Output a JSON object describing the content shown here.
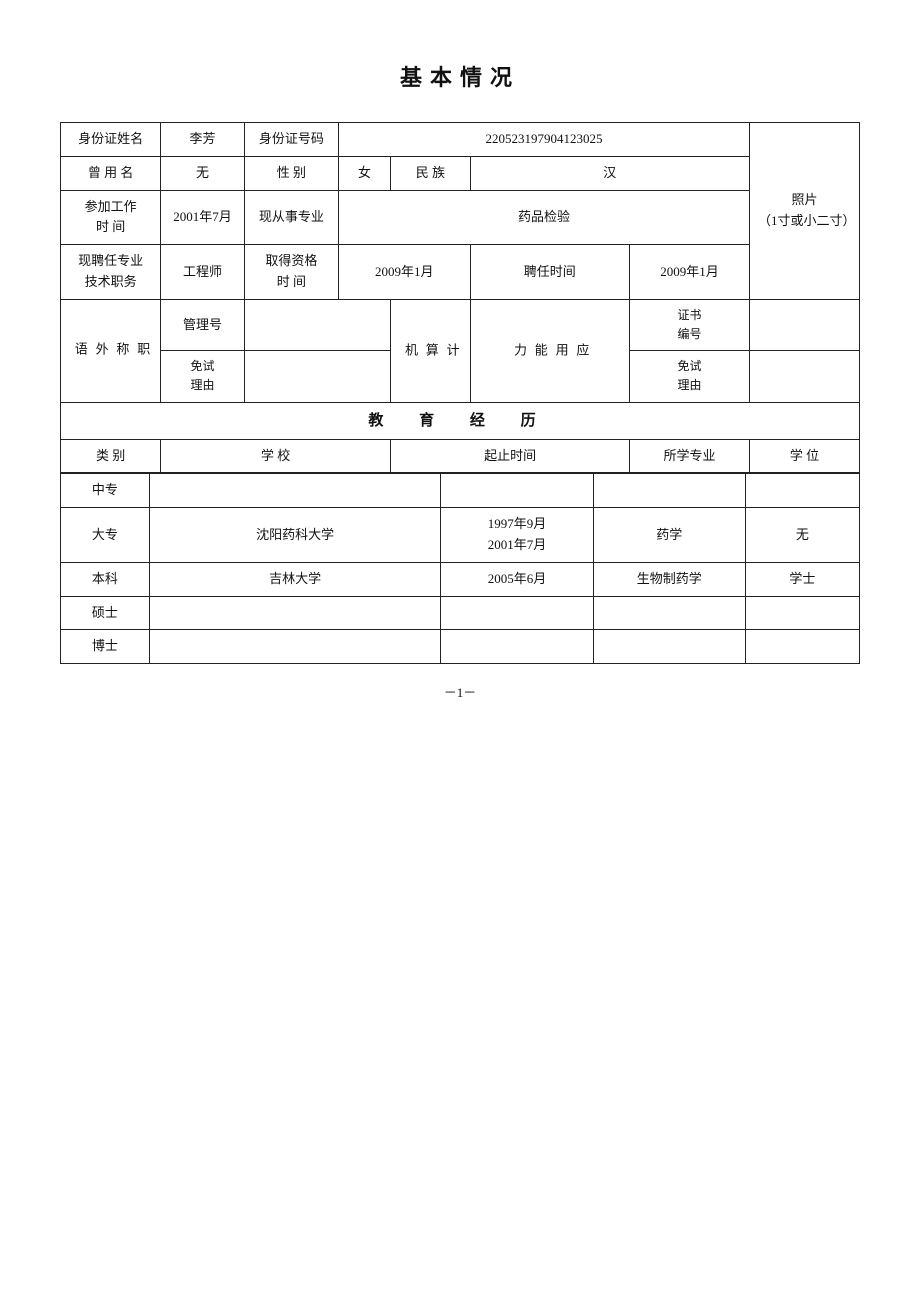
{
  "title": "基本情况",
  "rows": {
    "row1": {
      "id_name_label": "身份证姓名",
      "id_name_value": "李芳",
      "id_number_label": "身份证号码",
      "id_number_value": "220523197904123025",
      "photo_label": "照片",
      "photo_size": "（1寸或小二寸）"
    },
    "row2": {
      "former_name_label": "曾 用 名",
      "former_name_value": "无",
      "gender_label": "性 别",
      "gender_value": "女",
      "ethnicity_label": "民 族",
      "ethnicity_value": "汉"
    },
    "row3": {
      "work_start_label": "参加工作\n时  间",
      "work_start_value": "2001年7月",
      "current_major_label": "现从事专业",
      "current_major_value": "药品检验"
    },
    "row4": {
      "current_position_label": "现聘任专业\n技术职务",
      "current_position_value": "工程师",
      "qualification_time_label": "取得资格\n时  间",
      "qualification_time_value": "2009年1月",
      "hire_time_label": "聘任时间",
      "hire_time_value": "2009年1月"
    },
    "row5": {
      "title_foreign_label": "职\n称\n外\n语",
      "management_label": "管理号",
      "management_value": "",
      "computer_label": "计\n算\n机",
      "ability_label": "应\n用\n能\n力",
      "cert_num_label": "证书\n编号",
      "cert_num_value": "",
      "exempt_label1": "免试\n理由",
      "exempt_value1": "",
      "exempt_label2": "免试\n理由",
      "exempt_value2": ""
    },
    "edu_header": "教          育          经          历",
    "edu_cols": {
      "type": "类 别",
      "school": "学          校",
      "period": "起止时间",
      "major": "所学专业",
      "degree": "学  位"
    },
    "edu_rows": [
      {
        "type": "中专",
        "school": "",
        "period": "",
        "major": "",
        "degree": ""
      },
      {
        "type": "大专",
        "school": "沈阳药科大学",
        "period": "1997年9月\n2001年7月",
        "major": "药学",
        "degree": "无"
      },
      {
        "type": "本科",
        "school": "吉林大学",
        "period": "2005年6月",
        "major": "生物制药学",
        "degree": "学士"
      },
      {
        "type": "硕士",
        "school": "",
        "period": "",
        "major": "",
        "degree": ""
      },
      {
        "type": "博士",
        "school": "",
        "period": "",
        "major": "",
        "degree": ""
      }
    ]
  },
  "footer": "－1－"
}
